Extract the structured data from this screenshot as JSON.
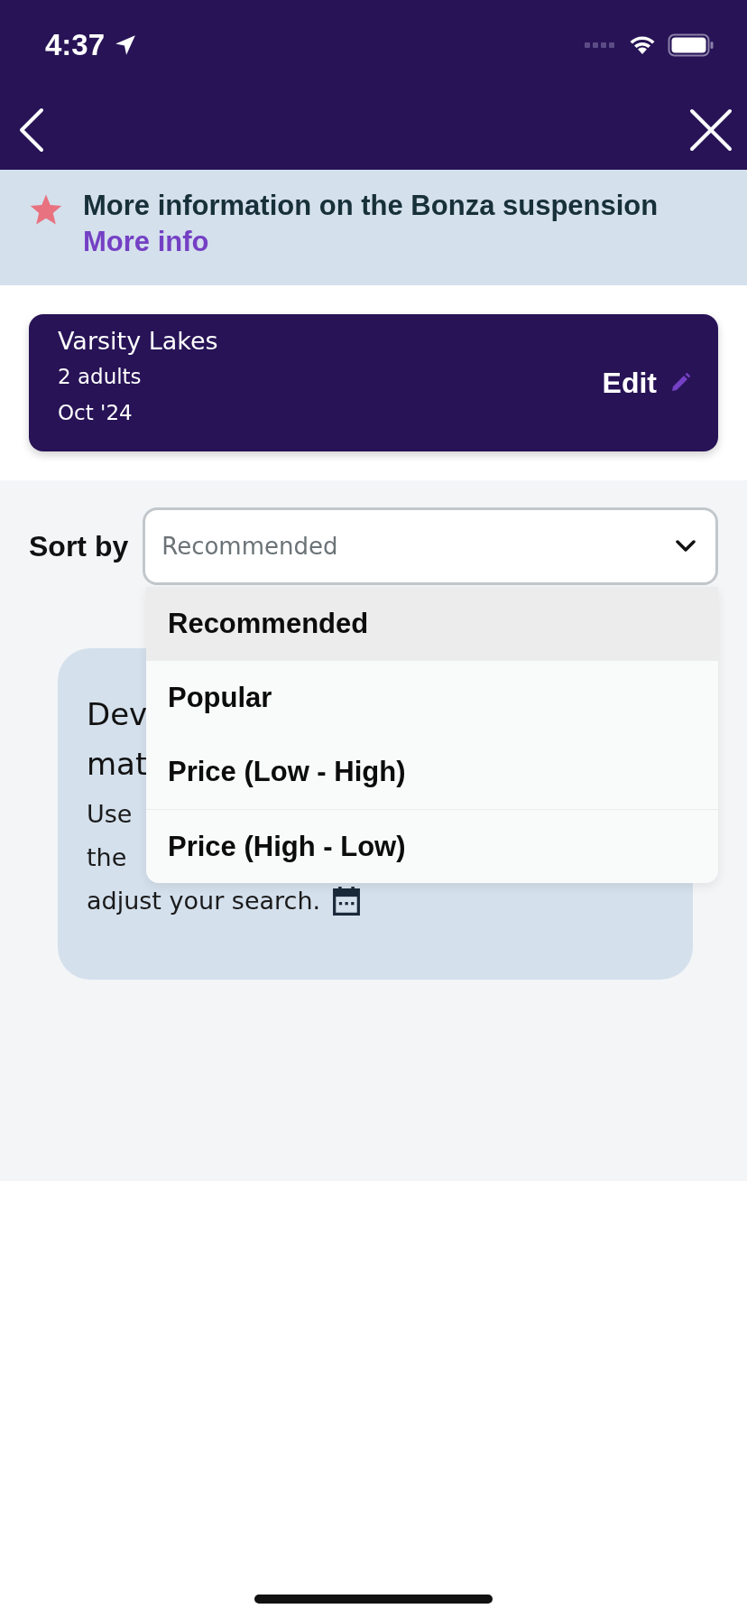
{
  "status_bar": {
    "time": "4:37"
  },
  "banner": {
    "text": "More information on the Bonza suspension",
    "link": "More info"
  },
  "search_summary": {
    "location": "Varsity Lakes",
    "guests": "2 adults",
    "date": "Oct '24",
    "edit": "Edit"
  },
  "sort": {
    "label": "Sort by",
    "value": "Recommended",
    "expanded": true,
    "options": [
      {
        "label": "Recommended",
        "selected": true
      },
      {
        "label": "Popular",
        "selected": false
      },
      {
        "label": "Price (Low - High)",
        "selected": false
      },
      {
        "label": "Price (High - Low)",
        "selected": false
      }
    ]
  },
  "info_card": {
    "title_lines": [
      "Dev",
      "mat"
    ],
    "body_lines": [
      "Use",
      "the",
      "adjust your search."
    ]
  }
}
